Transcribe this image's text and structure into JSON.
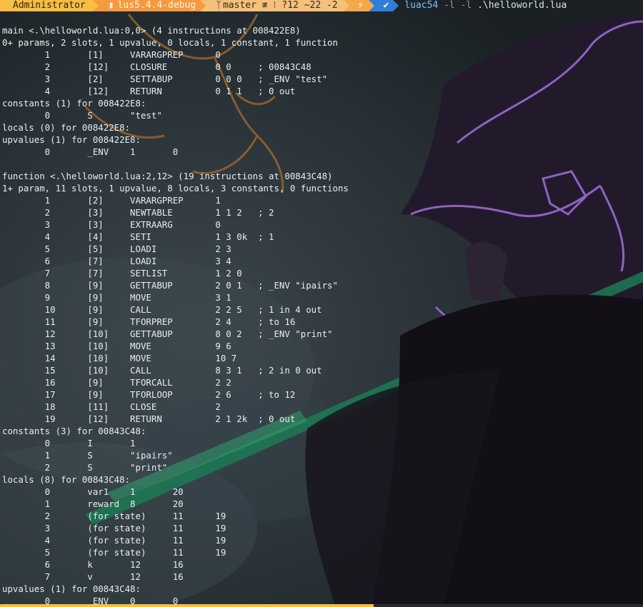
{
  "prompt": {
    "user": "Administrator",
    "dir_icon": "folder-icon",
    "dir": "lus5.4.4-debug",
    "git_icon": "branch-icon",
    "git": "master ≢ ⁝ ?12 ~22 -2",
    "bolt_icon": "lightning-icon",
    "ok_icon": "check-icon",
    "command_exe": "luac54",
    "command_flags": "-l -l",
    "command_arg": ".\\helloworld.lua"
  },
  "output_lines": [
    "main <.\\helloworld.lua:0,0> (4 instructions at 008422E8)",
    "0+ params, 2 slots, 1 upvalue, 0 locals, 1 constant, 1 function",
    "        1       [1]     VARARGPREP      0",
    "        2       [12]    CLOSURE         0 0     ; 00843C48",
    "        3       [2]     SETTABUP        0 0 0   ; _ENV \"test\"",
    "        4       [12]    RETURN          0 1 1   ; 0 out",
    "constants (1) for 008422E8:",
    "        0       S       \"test\"",
    "locals (0) for 008422E8:",
    "upvalues (1) for 008422E8:",
    "        0       _ENV    1       0",
    "",
    "function <.\\helloworld.lua:2,12> (19 instructions at 00843C48)",
    "1+ param, 11 slots, 1 upvalue, 8 locals, 3 constants, 0 functions",
    "        1       [2]     VARARGPREP      1",
    "        2       [3]     NEWTABLE        1 1 2   ; 2",
    "        3       [3]     EXTRAARG        0",
    "        4       [4]     SETI            1 3 0k  ; 1",
    "        5       [5]     LOADI           2 3",
    "        6       [7]     LOADI           3 4",
    "        7       [7]     SETLIST         1 2 0",
    "        8       [9]     GETTABUP        2 0 1   ; _ENV \"ipairs\"",
    "        9       [9]     MOVE            3 1",
    "        10      [9]     CALL            2 2 5   ; 1 in 4 out",
    "        11      [9]     TFORPREP        2 4     ; to 16",
    "        12      [10]    GETTABUP        8 0 2   ; _ENV \"print\"",
    "        13      [10]    MOVE            9 6",
    "        14      [10]    MOVE            10 7",
    "        15      [10]    CALL            8 3 1   ; 2 in 0 out",
    "        16      [9]     TFORCALL        2 2",
    "        17      [9]     TFORLOOP        2 6     ; to 12",
    "        18      [11]    CLOSE           2",
    "        19      [12]    RETURN          2 1 2k  ; 0 out",
    "constants (3) for 00843C48:",
    "        0       I       1",
    "        1       S       \"ipairs\"",
    "        2       S       \"print\"",
    "locals (8) for 00843C48:",
    "        0       var1    1       20",
    "        1       reward  8       20",
    "        2       (for state)     11      19",
    "        3       (for state)     11      19",
    "        4       (for state)     11      19",
    "        5       (for state)     11      19",
    "        6       k       12      16",
    "        7       v       12      16",
    "upvalues (1) for 00843C48:",
    "        0       _ENV    0       0"
  ],
  "colors": {
    "user_bg": "#f6be42",
    "dir_bg": "#f59a3e",
    "git_bg": "#f4c07a",
    "ok_bg": "#2f7fd8",
    "text": "#e9eef1",
    "background": "#1f2528"
  }
}
